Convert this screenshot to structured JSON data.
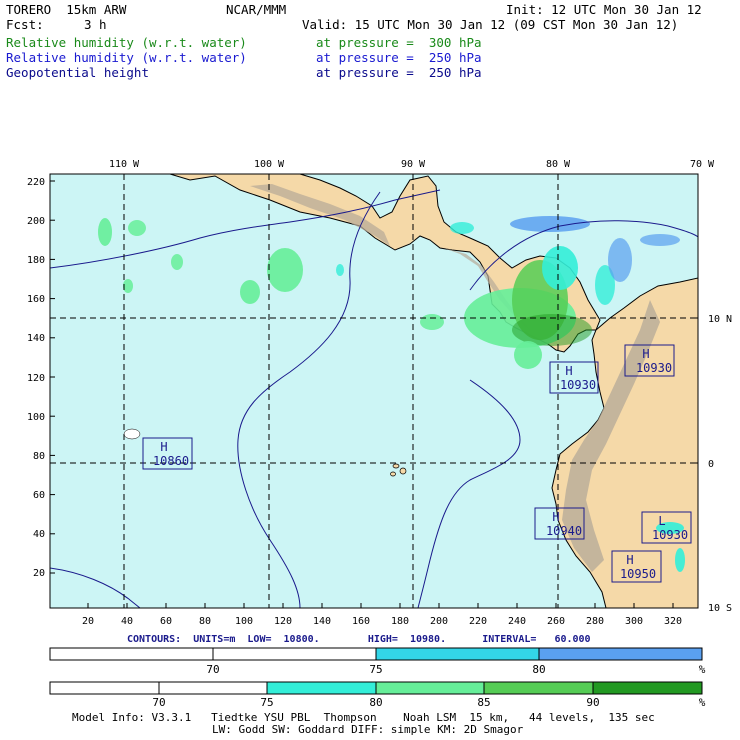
{
  "header": {
    "model": "TORERO  15km ARW",
    "center": "NCAR/MMM",
    "init": "Init: 12 UTC Mon 30 Jan 12",
    "fcst_label": "Fcst:",
    "fcst_value": "3 h",
    "valid": "Valid: 15 UTC Mon 30 Jan 12 (09 CST Mon 30 Jan 12)"
  },
  "fields": [
    {
      "name": "Relative humidity (w.r.t. water)",
      "level": "at pressure =  300 hPa",
      "color": "#1a8a1a"
    },
    {
      "name": "Relative humidity (w.r.t. water)",
      "level": "at pressure =  250 hPa",
      "color": "#1a1ad0"
    },
    {
      "name": "Geopotential height",
      "level": "at pressure =  250 hPa",
      "color": "#0a0a8c"
    }
  ],
  "map": {
    "top_lon_labels": [
      "110 W",
      "100 W",
      "90 W",
      "80 W",
      "70 W"
    ],
    "left_y_ticks": [
      "220",
      "200",
      "180",
      "160",
      "140",
      "120",
      "100",
      "80",
      "60",
      "40",
      "20"
    ],
    "bottom_x_ticks": [
      "20",
      "40",
      "60",
      "80",
      "100",
      "120",
      "140",
      "160",
      "180",
      "200",
      "220",
      "240",
      "260",
      "280",
      "300",
      "320"
    ],
    "right_lat_labels": [
      "10 N",
      "0",
      "10 S"
    ],
    "ocean_color": "#ccf5f5",
    "land_color": "#f5d9a8",
    "highs_lows": [
      {
        "type": "H",
        "value": "10860"
      },
      {
        "type": "H",
        "value": "10930"
      },
      {
        "type": "H",
        "value": "10930"
      },
      {
        "type": "H",
        "value": "10940"
      },
      {
        "type": "L",
        "value": "10930"
      },
      {
        "type": "H",
        "value": "10950"
      }
    ]
  },
  "contour_info": {
    "text": "CONTOURS:  UNITS=m  LOW=  10800.        HIGH=  10980.      INTERVAL=   60.000"
  },
  "colorbar_1": {
    "labels": [
      "70",
      "75",
      "80",
      "%"
    ],
    "colors": [
      "#ffffff",
      "#ffffff",
      "#33d6e8",
      "#5aa0f0"
    ]
  },
  "colorbar_2": {
    "labels": [
      "70",
      "75",
      "80",
      "85",
      "90",
      "%"
    ],
    "colors": [
      "#ffffff",
      "#ffffff",
      "#33eed8",
      "#66ee99",
      "#55cc55",
      "#229922"
    ]
  },
  "footer": {
    "line1": "Model Info: V3.3.1   Tiedtke YSU PBL  Thompson    Noah LSM  15 km,   44 levels,  135 sec",
    "line2": "LW: Godd SW: Goddard DIFF: simple KM: 2D Smagor"
  }
}
